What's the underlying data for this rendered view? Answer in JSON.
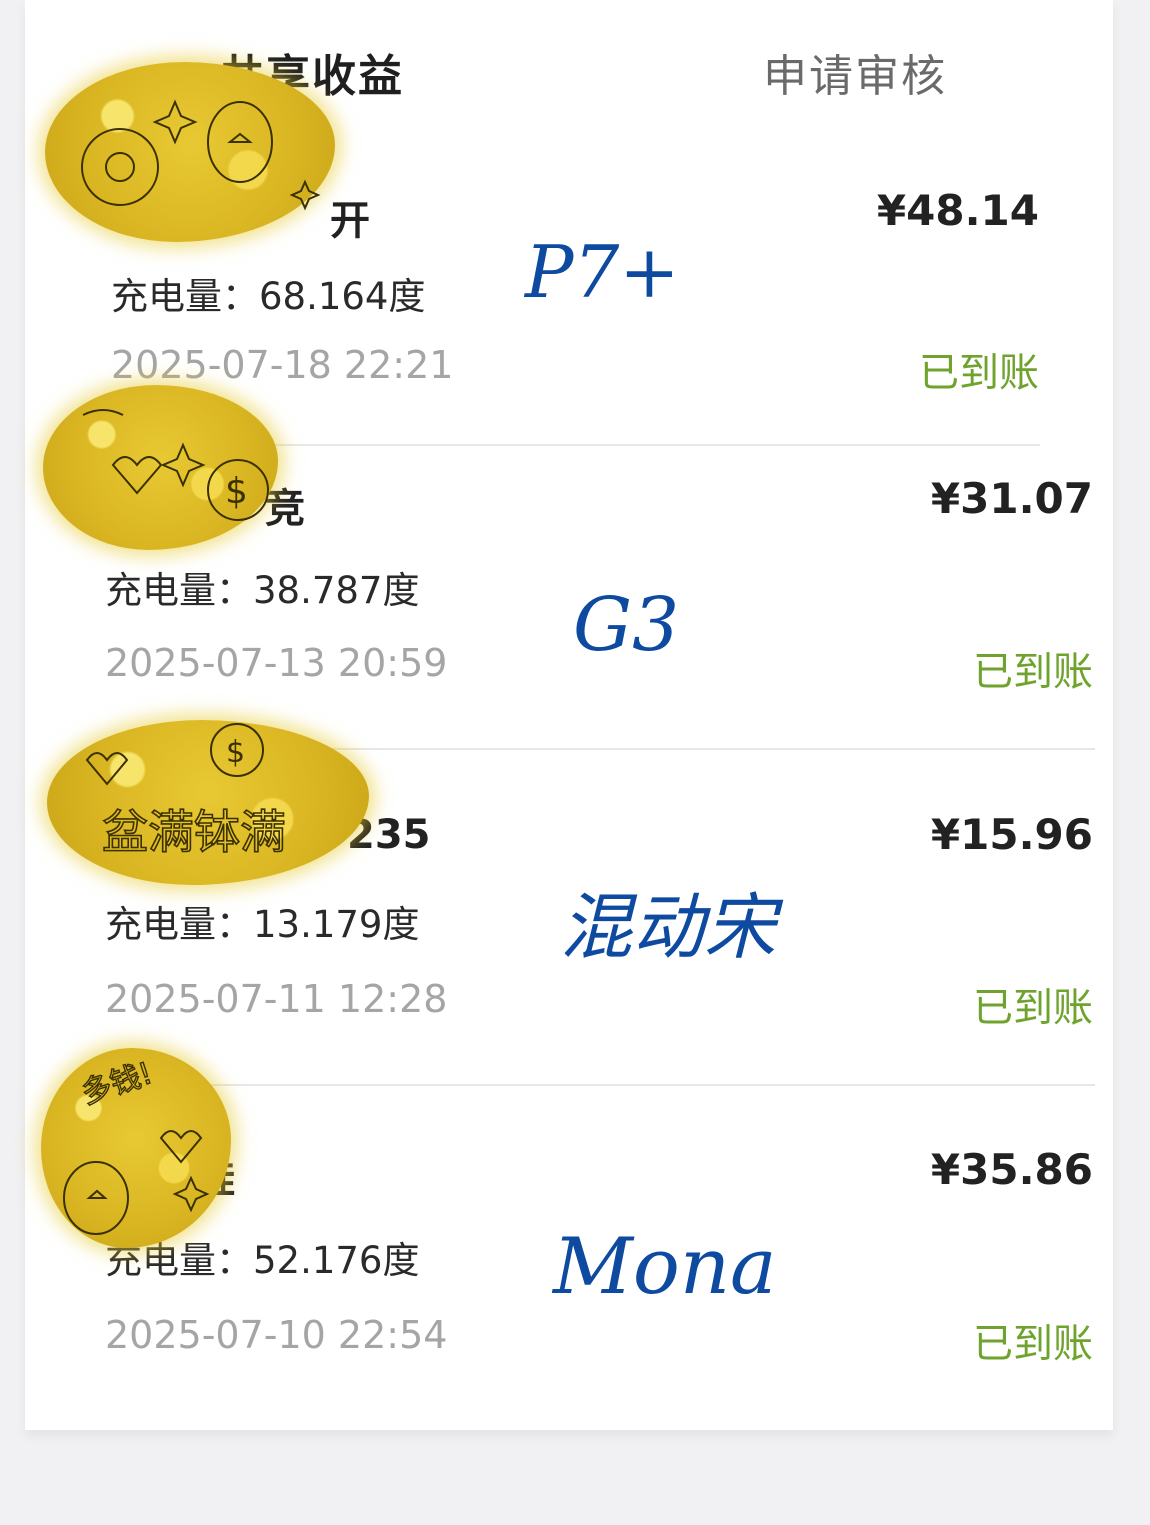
{
  "tabs": {
    "active": "共享收益",
    "inactive": "申请审核"
  },
  "colors": {
    "accent_green": "#8cc152",
    "status_green": "#6fa32e",
    "handwriting_blue": "#0d4aa0",
    "redaction_gold": "#d9b522"
  },
  "records": [
    {
      "name_suffix": "开",
      "amount": "¥48.14",
      "energy": "充电量：68.164度",
      "time": "2025-07-18 22:21",
      "status": "已到账",
      "annotation": "P7+"
    },
    {
      "name_suffix": "竞",
      "amount": "¥31.07",
      "energy": "充电量：38.787度",
      "time": "2025-07-13 20:59",
      "status": "已到账",
      "annotation": "G3"
    },
    {
      "name_suffix": "235",
      "amount": "¥15.96",
      "energy": "充电量：13.179度",
      "time": "2025-07-11 12:28",
      "status": "已到账",
      "annotation": "混动宋",
      "sticker_text": "盆满钵满"
    },
    {
      "name_suffix": "超蛙",
      "amount": "¥35.86",
      "energy": "充电量：52.176度",
      "time": "2025-07-10 22:54",
      "status": "已到账",
      "annotation": "Mona",
      "sticker_text": "多钱!"
    }
  ]
}
